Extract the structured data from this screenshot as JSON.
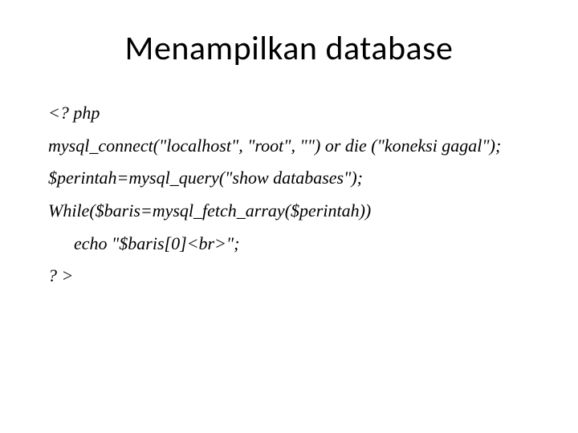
{
  "title": "Menampilkan database",
  "code": {
    "line1": "<? php",
    "line2": "mysql_connect(\"localhost\", \"root\", \"\") or die (\"koneksi gagal\");",
    "line3": "$perintah=mysql_query(\"show databases\");",
    "line4": "While($baris=mysql_fetch_array($perintah))",
    "line5": "echo \"$baris[0]<br>\";",
    "line6": "? >"
  }
}
